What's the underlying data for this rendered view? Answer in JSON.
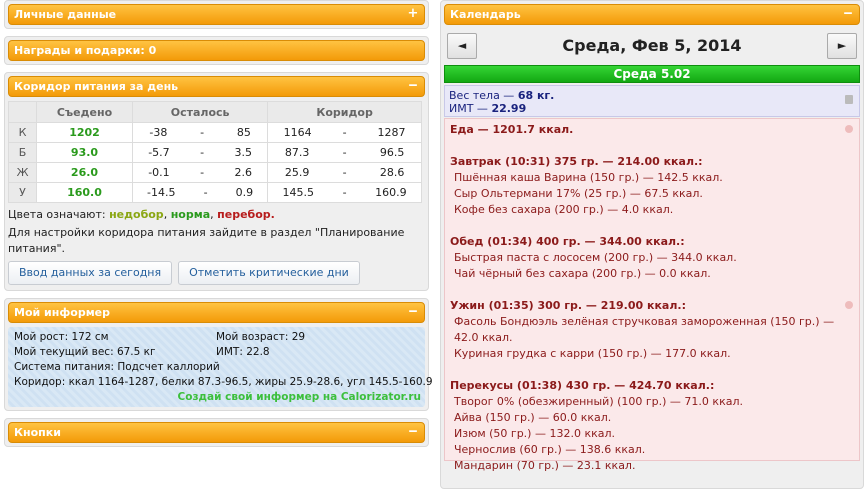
{
  "panels": {
    "personal": {
      "title": "Личные данные"
    },
    "awards": {
      "title": "Награды и подарки: 0"
    },
    "corridor": {
      "title": "Коридор питания за день",
      "headers": [
        "Съедено",
        "Осталось",
        "Коридор"
      ],
      "rows": [
        {
          "label": "К",
          "eaten": "1202",
          "left_min": "-38",
          "left_max": "85",
          "corr_min": "1164",
          "corr_max": "1287"
        },
        {
          "label": "Б",
          "eaten": "93.0",
          "left_min": "-5.7",
          "left_max": "3.5",
          "corr_min": "87.3",
          "corr_max": "96.5"
        },
        {
          "label": "Ж",
          "eaten": "26.0",
          "left_min": "-0.1",
          "left_max": "2.6",
          "corr_min": "25.9",
          "corr_max": "28.6"
        },
        {
          "label": "У",
          "eaten": "160.0",
          "left_min": "-14.5",
          "left_max": "0.9",
          "corr_min": "145.5",
          "corr_max": "160.9"
        }
      ],
      "legend_prefix": "Цвета означают:",
      "legend_under": "недобор",
      "legend_norm": "норма",
      "legend_over": "перебор.",
      "note": "Для настройки коридора питания зайдите в раздел \"Планирование питания\".",
      "btn_enter": "Ввод данных за сегодня",
      "btn_critical": "Отметить критические дни"
    },
    "informer": {
      "title": "Мой информер",
      "height": "Мой рост: 172 см",
      "age": "Мой возраст: 29",
      "weight": "Мой текущий вес: 67.5 кг",
      "bmi": "ИМТ: 22.8",
      "system": "Система питания: Подсчет каллорий",
      "corridor": "Коридор: ккал 1164-1287, белки 87.3-96.5, жиры 25.9-28.6, угл 145.5-160.9",
      "promo": "Создай свой информер на Calorizator.ru"
    },
    "buttons": {
      "title": "Кнопки"
    },
    "calendar": {
      "title": "Календарь",
      "date": "Среда, Фев 5, 2014",
      "prev": "◄",
      "next": "►",
      "daybar": "Среда 5.02",
      "weight_label": "Вес тела —",
      "weight_value": "68 кг.",
      "bmi_label": "ИМТ —",
      "bmi_value": "22.99",
      "food_total": "Еда — 1201.7 ккал.",
      "meals": [
        {
          "head": "Завтрак (10:31) 375 гр. — 214.00 ккал.:",
          "items": [
            "Пшённая каша Варина (150 гр.) — 142.5 ккал.",
            "Сыр Ольтермани 17% (25 гр.) — 67.5 ккал.",
            "Кофе без сахара (200 гр.) — 4.0 ккал."
          ]
        },
        {
          "head": "Обед (01:34) 400 гр. — 344.00 ккал.:",
          "items": [
            "Быстрая паста с лососем (200 гр.) — 344.0 ккал.",
            "Чай чёрный без сахара (200 гр.) — 0.0 ккал."
          ]
        },
        {
          "head": "Ужин (01:35) 300 гр. — 219.00 ккал.:",
          "items": [
            "Фасоль Бондюэль зелёная стручковая замороженная (150 гр.) — 42.0 ккал.",
            "Куриная грудка с карри (150 гр.) — 177.0 ккал."
          ]
        },
        {
          "head": "Перекусы (01:38) 430 гр. — 424.70 ккал.:",
          "items": [
            "Творог 0% (обезжиренный) (100 гр.) — 71.0 ккал.",
            "Айва (150 гр.) — 60.0 ккал.",
            "Изюм (50 гр.) — 132.0 ккал.",
            "Чернослив (60 гр.) — 138.6 ккал.",
            "Мандарин (70 гр.) — 23.1 ккал."
          ]
        }
      ]
    }
  },
  "icons": {
    "expand": "+",
    "collapse": "‒"
  }
}
